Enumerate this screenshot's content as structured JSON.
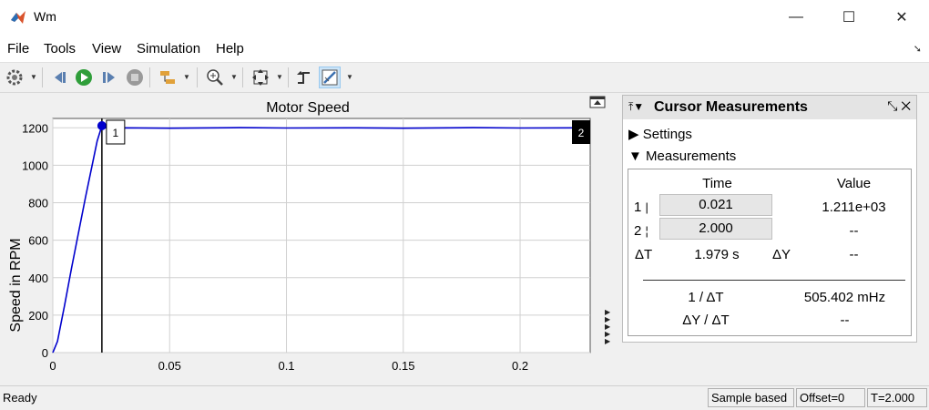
{
  "window": {
    "title": "Wm",
    "minimize": "—",
    "maximize": "☐",
    "close": "✕"
  },
  "menu": [
    "File",
    "Tools",
    "View",
    "Simulation",
    "Help"
  ],
  "plot": {
    "title": "Motor Speed",
    "ylabel": "Speed in RPM"
  },
  "chart_data": {
    "type": "line",
    "title": "Motor Speed",
    "xlabel": "",
    "ylabel": "Speed in RPM",
    "xlim": [
      0,
      0.23
    ],
    "ylim": [
      0,
      1250
    ],
    "xticks": [
      "0",
      "0.05",
      "0.1",
      "0.15",
      "0.2"
    ],
    "yticks": [
      "0",
      "200",
      "400",
      "600",
      "800",
      "1000",
      "1200"
    ],
    "grid": true,
    "series": [
      {
        "color": "#0000cd",
        "x": [
          0,
          0.002,
          0.005,
          0.008,
          0.011,
          0.014,
          0.017,
          0.019,
          0.021,
          0.023,
          0.03,
          0.05,
          0.08,
          0.1,
          0.13,
          0.15,
          0.18,
          0.2,
          0.23
        ],
        "y": [
          0,
          60,
          250,
          450,
          640,
          830,
          1010,
          1130,
          1211,
          1198,
          1200,
          1198,
          1201,
          1199,
          1200,
          1198,
          1201,
          1199,
          1200
        ]
      }
    ],
    "cursors": [
      {
        "label": "1",
        "x": 0.021,
        "y": 1211
      },
      {
        "label": "2"
      }
    ]
  },
  "cursor_panel": {
    "title": "Cursor Measurements",
    "settings_label": "Settings",
    "measurements_label": "Measurements",
    "col_time": "Time",
    "col_value": "Value",
    "row1_label": "1",
    "row1_time": "0.021",
    "row1_value": "1.211e+03",
    "row2_label": "2",
    "row2_time": "2.000",
    "row2_value": "--",
    "delta_t_label": "ΔT",
    "delta_t_value": "1.979 s",
    "delta_y_label": "ΔY",
    "delta_y_value": "--",
    "inv_dt_label": "1 / ΔT",
    "inv_dt_value": "505.402 mHz",
    "dy_dt_label": "ΔY / ΔT",
    "dy_dt_value": "--"
  },
  "status": {
    "ready": "Ready",
    "mode": "Sample based",
    "offset": "Offset=0",
    "time": "T=2.000"
  }
}
